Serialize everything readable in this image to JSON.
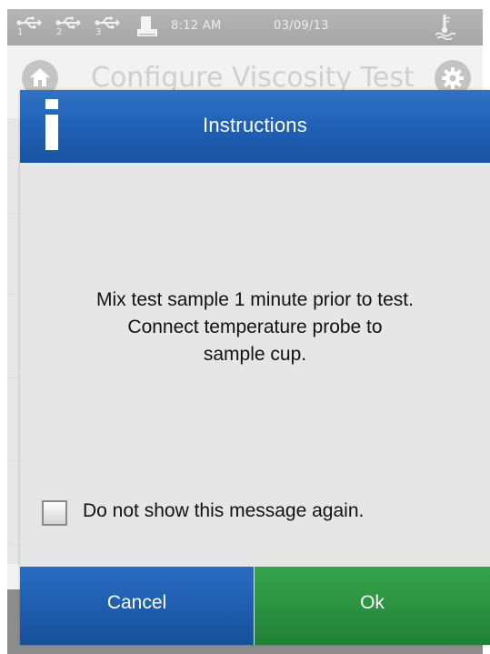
{
  "status_bar": {
    "usb_ports": [
      {
        "label": "1",
        "icon": "usb-icon"
      },
      {
        "label": "2",
        "icon": "usb-icon"
      },
      {
        "label": "3",
        "icon": "usb-icon"
      }
    ],
    "printer_icon": "printer-icon",
    "time": "8:12 AM",
    "date": "03/09/13",
    "probe_icon": "temperature-probe-icon"
  },
  "background_screen": {
    "title": "Configure Viscosity Test",
    "home_icon": "home-icon",
    "settings_icon": "gear-icon"
  },
  "dialog": {
    "icon": "info-icon",
    "title": "Instructions",
    "message_lines": [
      "Mix test sample  1 minute prior to test.",
      "Connect temperature probe to",
      "sample cup."
    ],
    "checkbox": {
      "label": "Do not show this message again.",
      "checked": false
    },
    "buttons": {
      "cancel_label": "Cancel",
      "ok_label": "Ok"
    }
  },
  "colors": {
    "header_blue": "#2266b8",
    "cancel_blue": "#1f5eb0",
    "ok_green": "#2b9341",
    "status_gray": "#aeaeae"
  }
}
